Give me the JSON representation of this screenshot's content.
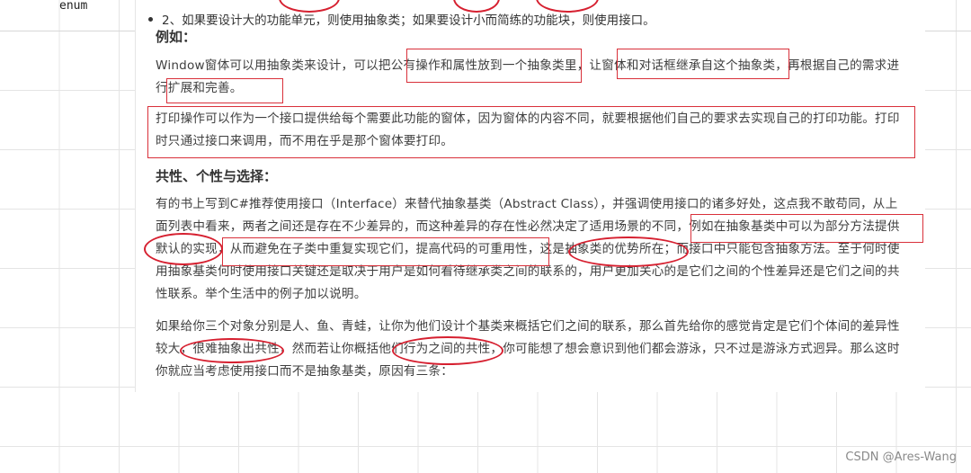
{
  "code_label": "enum",
  "bullet": "2、如果要设计大的功能单元，则使用抽象类；如果要设计小而简练的功能块，则使用接口。",
  "example": {
    "heading": "例如：",
    "para1_lines": [
      "Window窗体可以用抽象类来设计，可以把公有操作和属性放到一个抽象类里，让窗体和对话框继承自这个抽象类，再根据自己的需求进",
      "行扩展和完善。"
    ],
    "para2_lines": [
      "打印操作可以作为一个接口提供给每个需要此功能的窗体，因为窗体的内容不同，就要根据他们自己的要求去实现自己的打印功能。打印",
      "时只通过接口来调用，而不用在乎是那个窗体要打印。"
    ]
  },
  "commonality": {
    "heading": "共性、个性与选择：",
    "para1_lines": [
      "有的书上写到C#推荐使用接口（Interface）来替代抽象基类（Abstract Class），并强调使用接口的诸多好处，这点我不敢苟同，从上",
      "面列表中看来，两者之间还是存在不少差异的，而这种差异的存在性必然决定了适用场景的不同，例如在抽象基类中可以为部分方法提供",
      "默认的实现，从而避免在子类中重复实现它们，提高代码的可重用性，这是抽象类的优势所在；而接口中只能包含抽象方法。至于何时使",
      "用抽象基类何时使用接口关键还是取决于用户是如何看待继承类之间的联系的，用户更加关心的是它们之间的个性差异还是它们之间的共",
      "性联系。举个生活中的例子加以说明。"
    ],
    "para2_lines": [
      "如果给你三个对象分别是人、鱼、青蛙，让你为他们设计个基类来概括它们之间的联系，那么首先给你的感觉肯定是它们个体间的差异性",
      "较大，很难抽象出共性，然而若让你概括他们行为之间的共性，你可能想了想会意识到他们都会游泳，只不过是游泳方式迥异。那么这时",
      "你就应当考虑使用接口而不是抽象基类，原因有三条："
    ]
  },
  "annotation_color": "#d9303a",
  "watermark": "CSDN @Ares-Wang"
}
